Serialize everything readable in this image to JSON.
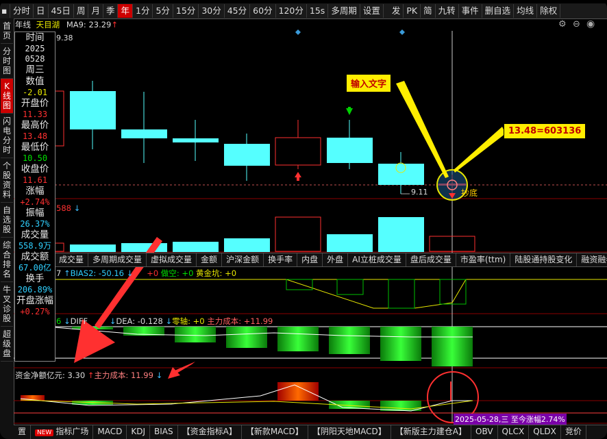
{
  "toolbar": {
    "items": [
      "分时",
      "日",
      "45日",
      "周",
      "月",
      "季",
      "年",
      "1分",
      "5分",
      "15分",
      "30分",
      "45分",
      "60分",
      "120分",
      "15s",
      "多周期",
      "设置"
    ],
    "active_index": 6,
    "right_items": [
      "发",
      "PK",
      "简",
      "九转",
      "事件",
      "删自选",
      "均线",
      "除权"
    ]
  },
  "sidebar": {
    "tabs": [
      "首页",
      "分时图",
      "K线图",
      "闪电分时",
      "个股资料",
      "自选股",
      "综合排名",
      "牛叉诊股",
      "超级盘"
    ],
    "active_index": 2
  },
  "chart_header": {
    "period": "年线",
    "name": "天目湖",
    "ma_label": "MA9: 23.29",
    "price_label": "9.38"
  },
  "info_panel": {
    "rows": [
      {
        "label": "时间",
        "value": "2025",
        "value2": "0528",
        "class": "w"
      },
      {
        "label": "周三",
        "value": "",
        "class": "w"
      },
      {
        "label": "数值",
        "value": "-2.01",
        "class": "y"
      },
      {
        "label": "开盘价",
        "value": "11.33",
        "class": "r"
      },
      {
        "label": "最高价",
        "value": "13.48",
        "class": "r"
      },
      {
        "label": "最低价",
        "value": "10.50",
        "class": "g"
      },
      {
        "label": "收盘价",
        "value": "11.61",
        "class": "r"
      },
      {
        "label": "涨幅",
        "value": "+2.74%",
        "class": "r"
      },
      {
        "label": "振幅",
        "value": "26.37%",
        "class": "c"
      },
      {
        "label": "成交量",
        "value": "558.9万",
        "class": "c"
      },
      {
        "label": "成交额",
        "value": "67.00亿",
        "class": "c"
      },
      {
        "label": "换手",
        "value": "206.89%",
        "class": "c"
      },
      {
        "label": "开盘涨幅",
        "value": "+0.27%",
        "class": "r"
      }
    ]
  },
  "annotations": {
    "input_text": "输入文字",
    "price_tag": "13.48=603136",
    "low_label": "9.11",
    "bottom_label": "抄底",
    "date_tag": "2025-05-28,三 至今涨幅2.74%"
  },
  "volume_header": {
    "value": "588"
  },
  "indicator_tabs": [
    "成交量",
    "多周期成交量",
    "虚拟成交量",
    "金额",
    "沪深金额",
    "换手率",
    "内盘",
    "外盘",
    "AI立桩成交量",
    "盘后成交量",
    "市盈率(ttm)",
    "陆股通持股变化",
    "融资融券变"
  ],
  "bias_header": {
    "label1": "7",
    "label2": "BIAS2: -50.16",
    "label3": "+0",
    "label4": "做空: +0",
    "label5": "黄金坑: +0"
  },
  "macd_header": {
    "label1": "6",
    "label2": "DIFF",
    "label3": "DEA: -0.128",
    "label4": "零轴: +0",
    "label5": "主力成本: +11.99"
  },
  "fund_header": {
    "label1": "资金净额亿元:",
    "value1": "3.30",
    "label2": "主力成本:",
    "value2": "11.99"
  },
  "bottom_tabs": [
    "置",
    "指标广场",
    "MACD",
    "KDJ",
    "BIAS",
    "【资金指标A】",
    "【新款MACD】",
    "【阴阳天地MACD】",
    "【新版主力建仓A】",
    "OBV",
    "QLCX",
    "QLDX",
    "竞价"
  ],
  "new_badge": "NEW",
  "colors": {
    "up": "#ff3030",
    "down": "#55ffff",
    "accent": "#ffee00",
    "active": "#cc0000"
  }
}
